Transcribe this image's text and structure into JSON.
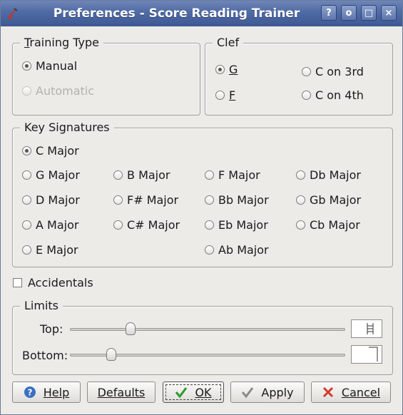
{
  "window": {
    "title": "Preferences - Score Reading Trainer",
    "buttons": [
      "?",
      "o",
      "□",
      "×"
    ]
  },
  "training_type": {
    "legend": "Training Type",
    "options": [
      {
        "label": "Manual",
        "checked": true,
        "enabled": true
      },
      {
        "label": "Automatic",
        "checked": false,
        "enabled": false
      }
    ]
  },
  "clef": {
    "legend": "Clef",
    "options": [
      {
        "label": "G",
        "checked": true
      },
      {
        "label": "C on 3rd",
        "checked": false
      },
      {
        "label": "F",
        "checked": false
      },
      {
        "label": "C on 4th",
        "checked": false
      }
    ]
  },
  "key_signatures": {
    "legend": "Key Signatures",
    "selected": "C Major",
    "c_major": "C Major",
    "col1": [
      "G Major",
      "D Major",
      "A Major",
      "E Major"
    ],
    "col2": [
      "B Major",
      "F# Major",
      "C# Major"
    ],
    "col3": [
      "F Major",
      "Bb Major",
      "Eb Major",
      "Ab Major"
    ],
    "col4": [
      "Db Major",
      "Gb Major",
      "Cb Major"
    ]
  },
  "accidentals": {
    "label": "Accidentals",
    "checked": false
  },
  "limits": {
    "legend": "Limits",
    "top_label": "Top:",
    "bottom_label": "Bottom:",
    "top_value": 0.22,
    "bottom_value": 0.15
  },
  "buttons": {
    "help": "Help",
    "defaults": "Defaults",
    "ok": "OK",
    "apply": "Apply",
    "cancel": "Cancel"
  },
  "colors": {
    "titlebar": "#4f6aa4",
    "help_icon": "#3a6fc2",
    "ok_check": "#2e9a2e",
    "cancel_x": "#d23a2a"
  }
}
